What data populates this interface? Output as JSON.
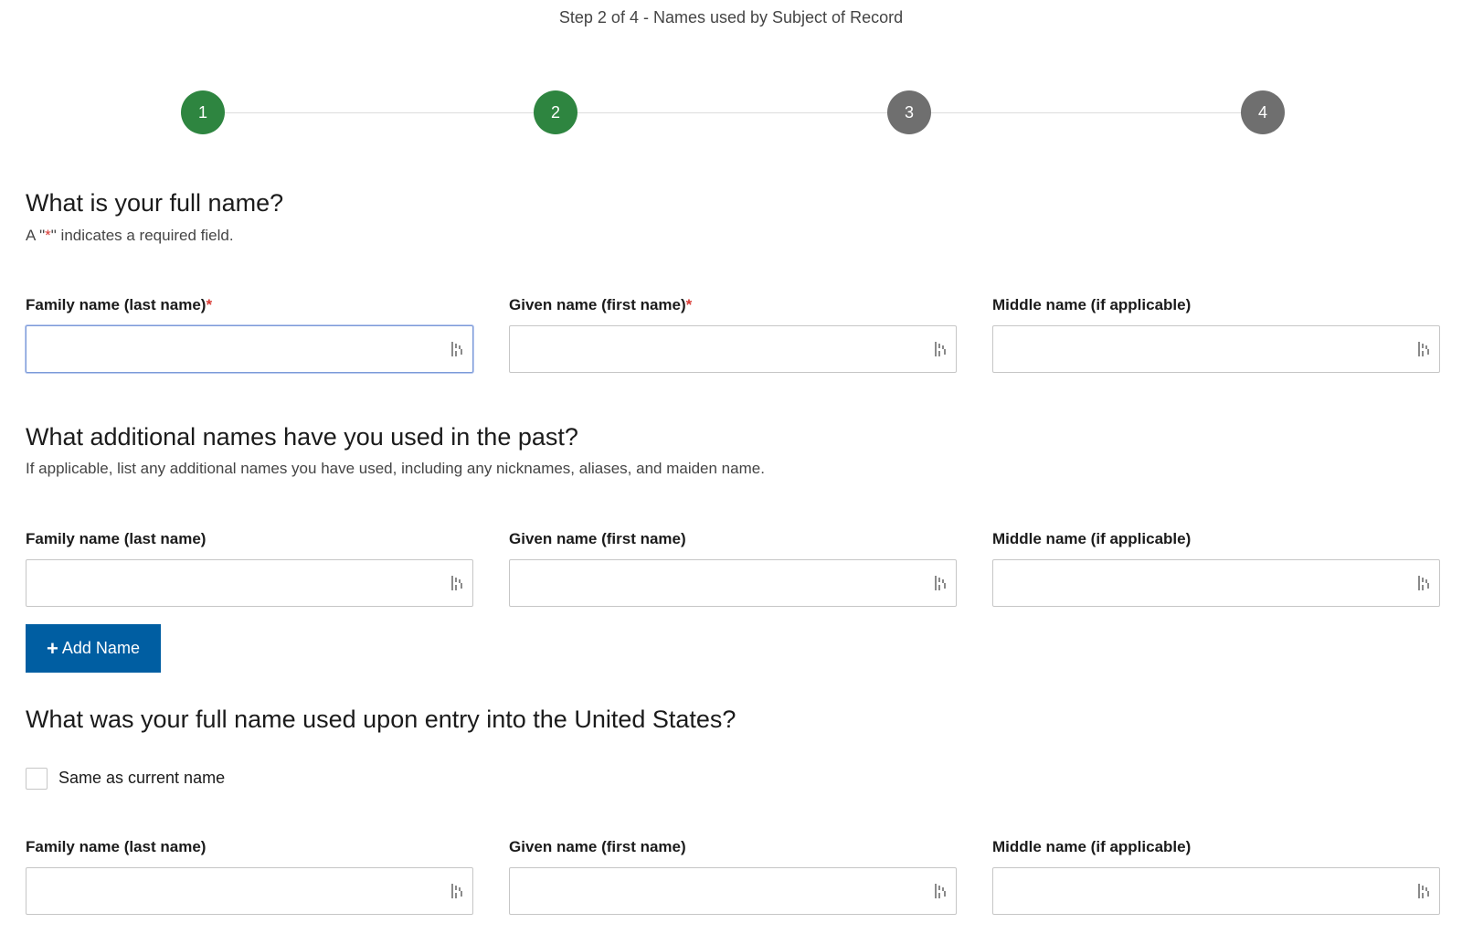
{
  "header": {
    "step_title": "Step 2 of 4 - Names used by Subject of Record"
  },
  "stepper": {
    "steps": [
      {
        "label": "1",
        "state": "complete"
      },
      {
        "label": "2",
        "state": "current"
      },
      {
        "label": "3",
        "state": "upcoming"
      },
      {
        "label": "4",
        "state": "upcoming"
      }
    ],
    "colors": {
      "active": "#2e8540",
      "inactive": "#6f6f6f",
      "line": "#dcdcdc"
    }
  },
  "full_name": {
    "heading": "What is your full name?",
    "required_note_prefix": "A \"",
    "required_note_mark": "*",
    "required_note_suffix": "\" indicates a required field.",
    "family_label": "Family name (last name)",
    "given_label": "Given name (first name)",
    "middle_label": "Middle name (if applicable)",
    "required_mark": "*",
    "family_value": "",
    "given_value": "",
    "middle_value": ""
  },
  "additional_names": {
    "heading": "What additional names have you used in the past?",
    "description": "If applicable, list any additional names you have used, including any nicknames, aliases, and maiden name.",
    "family_label": "Family name (last name)",
    "given_label": "Given name (first name)",
    "middle_label": "Middle name (if applicable)",
    "family_value": "",
    "given_value": "",
    "middle_value": "",
    "add_button_label": "Add Name",
    "add_button_icon": "plus-icon"
  },
  "entry_name": {
    "heading": "What was your full name used upon entry into the United States?",
    "same_as_current_label": "Same as current name",
    "same_as_current_checked": false,
    "family_label": "Family name (last name)",
    "given_label": "Given name (first name)",
    "middle_label": "Middle name (if applicable)",
    "family_value": "",
    "given_value": "",
    "middle_value": ""
  },
  "field_icon": "autofill-key-icon",
  "colors": {
    "primary_button": "#005ea2",
    "required": "#d83933",
    "focus_border": "#7c9ad8"
  }
}
